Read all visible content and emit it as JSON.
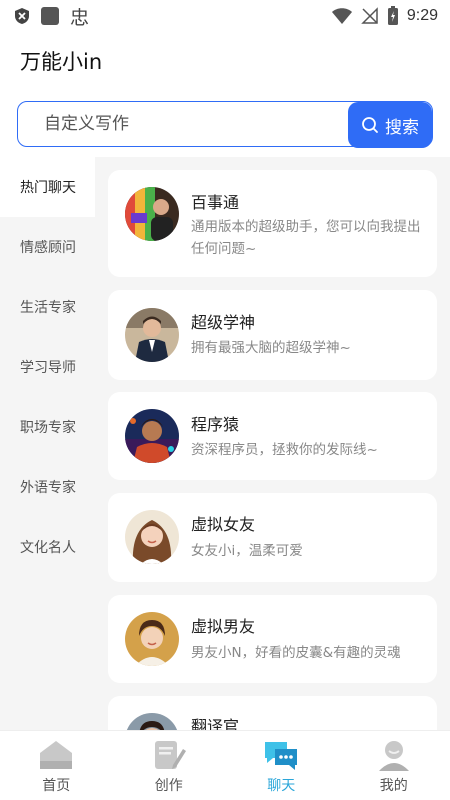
{
  "status_bar": {
    "time": "9:29",
    "app_icon_glyph": "忠"
  },
  "header": {
    "title": "万能小in"
  },
  "search": {
    "placeholder": "自定义写作",
    "button_label": "搜索"
  },
  "sidebar": {
    "items": [
      {
        "label": "热门聊天",
        "active": true
      },
      {
        "label": "情感顾问"
      },
      {
        "label": "生活专家"
      },
      {
        "label": "学习导师"
      },
      {
        "label": "职场专家"
      },
      {
        "label": "外语专家"
      },
      {
        "label": "文化名人"
      }
    ]
  },
  "bots": [
    {
      "name": "百事通",
      "desc": "通用版本的超级助手，您可以向我提出任何问题~"
    },
    {
      "name": "超级学神",
      "desc": "拥有最强大脑的超级学神~"
    },
    {
      "name": "程序猿",
      "desc": "资深程序员，拯救你的发际线~"
    },
    {
      "name": "虚拟女友",
      "desc": "女友小i，温柔可爱"
    },
    {
      "name": "虚拟男友",
      "desc": "男友小N，好看的皮囊&有趣的灵魂"
    },
    {
      "name": "翻译官",
      "desc": ""
    }
  ],
  "bottom_nav": {
    "items": [
      {
        "label": "首页",
        "icon": "home-icon"
      },
      {
        "label": "创作",
        "icon": "write-icon"
      },
      {
        "label": "聊天",
        "icon": "chat-icon",
        "active": true
      },
      {
        "label": "我的",
        "icon": "profile-icon"
      }
    ]
  },
  "colors": {
    "accent": "#2f6cf6",
    "active_nav": "#2aa6d9",
    "sidebar_bg": "#f5f5f5"
  }
}
